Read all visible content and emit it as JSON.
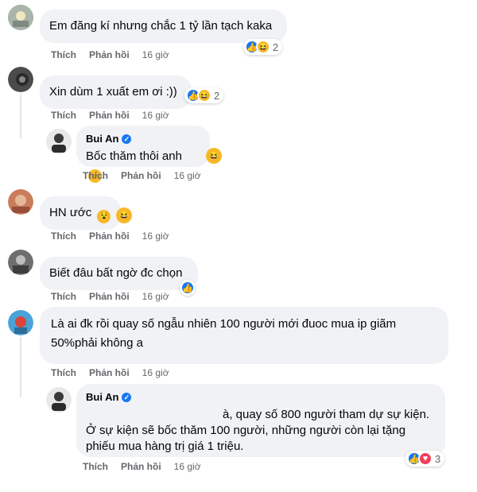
{
  "labels": {
    "like": "Thích",
    "reply": "Phản hồi"
  },
  "comments": [
    {
      "text": "Em đăng kí nhưng chắc 1 tỷ lần tạch kaka",
      "time": "16 giờ",
      "reaction_count": "2"
    },
    {
      "text": "Xin dùm 1 xuất em ơi :))",
      "time": "16 giờ",
      "reaction_count": "2"
    },
    {
      "name": "Bui An",
      "text": "Bốc thăm thôi anh",
      "time": "16 giờ"
    },
    {
      "text": "HN ước",
      "time": "16 giờ"
    },
    {
      "text": "Biết đâu bất ngờ đc chọn",
      "time": "16 giờ"
    },
    {
      "text_line1": "Là ai đk rồi quay số ngẫu nhiên 100 người mới đuoc mua ip giãm",
      "text_line2": "50%phải không a",
      "time": "16 giờ"
    },
    {
      "name": "Bui An",
      "text_line1": "à, quay số 800 người tham dự sự kiện.",
      "text_line2": "Ở sự kiện sẽ bốc thăm 100 người, những người còn lại tặng",
      "text_line3": "phiếu mua hàng trị giá 1 triệu.",
      "time": "16 giờ",
      "reaction_count": "3"
    }
  ],
  "colors": {
    "bubble": "#f0f2f5",
    "meta": "#65676b",
    "like": "#1877f2",
    "haha": "#f7b928",
    "love": "#f33e58"
  },
  "icons": [
    "like-reaction-icon",
    "haha-reaction-icon",
    "love-reaction-icon",
    "verified-badge-icon",
    "grinning-emoji",
    "laughing-emoji",
    "pacman-emoji"
  ]
}
